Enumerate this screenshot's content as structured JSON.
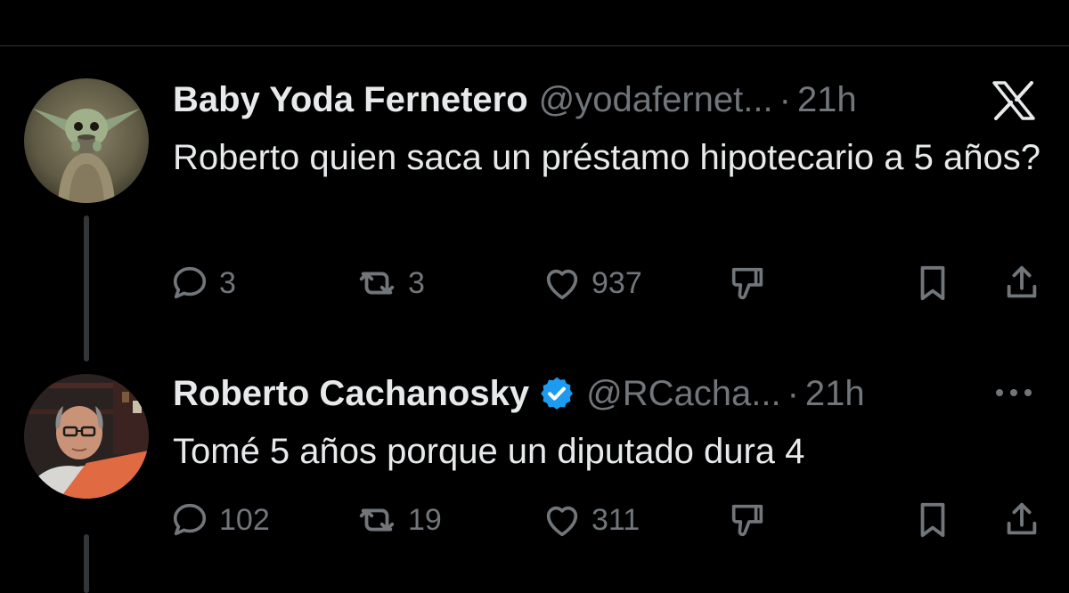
{
  "tweets": [
    {
      "display_name": "Baby Yoda Fernetero",
      "handle": "@yodafernet...",
      "separator": "·",
      "time": "21h",
      "text": "Roberto quien saca un préstamo hipotecario a 5 años?",
      "verified": false,
      "corner_icon": "x-logo-icon",
      "avatar": "baby-yoda-avatar",
      "actions": {
        "replies": "3",
        "reposts": "3",
        "likes": "937"
      }
    },
    {
      "display_name": "Roberto Cachanosky",
      "handle": "@RCacha...",
      "separator": "·",
      "time": "21h",
      "text": "Tomé 5 años porque un diputado dura 4",
      "verified": true,
      "corner_icon": "more-options-icon",
      "avatar": "roberto-avatar",
      "actions": {
        "replies": "102",
        "reposts": "19",
        "likes": "311"
      }
    }
  ],
  "colors": {
    "background": "#000000",
    "text_primary": "#e7e9ea",
    "text_secondary": "#71767b",
    "verified_badge": "#1d9bf0",
    "divider": "#2f3336",
    "thread_line": "#333639"
  }
}
